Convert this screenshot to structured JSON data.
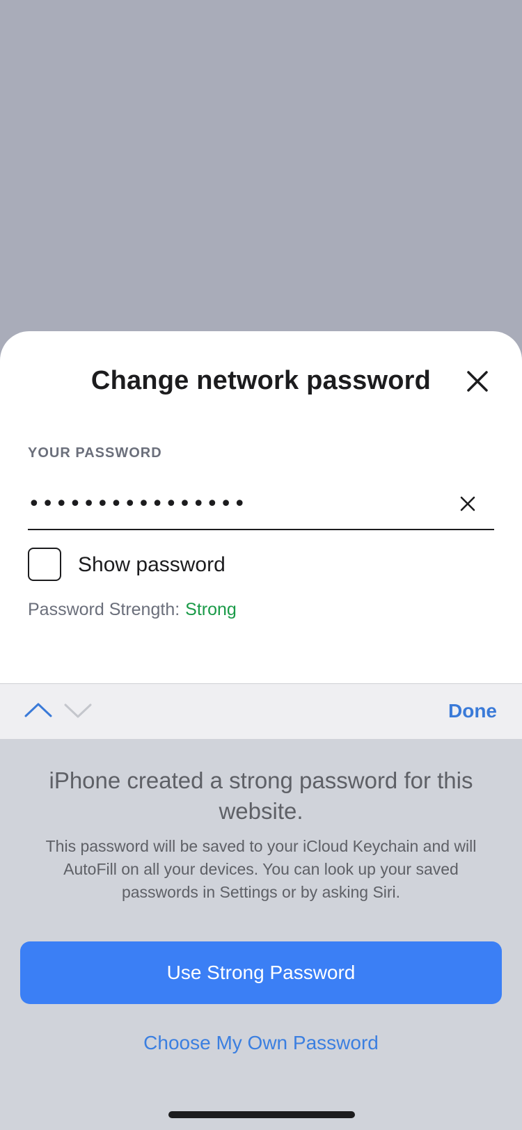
{
  "sheet": {
    "title": "Change network password",
    "password_label": "YOUR PASSWORD",
    "password_value": "••••••••••••••••",
    "show_password_label": "Show password",
    "show_password_checked": false,
    "strength_label": "Password Strength:",
    "strength_value": "Strong",
    "strength_color": "#1a9a48"
  },
  "keyboard_toolbar": {
    "done_label": "Done",
    "accent_color": "#3a7ad8"
  },
  "password_suggestion": {
    "title": "iPhone created a strong password for this website.",
    "description": "This password will be saved to your iCloud Keychain and will AutoFill on all your devices. You can look up your saved passwords in Settings or by asking Siri.",
    "primary_button": "Use Strong Password",
    "secondary_link": "Choose My Own Password",
    "primary_color": "#3b7ff5"
  },
  "icons": {
    "close": "close-icon",
    "clear": "clear-icon",
    "previous": "chevron-up-icon",
    "next": "chevron-down-icon"
  }
}
